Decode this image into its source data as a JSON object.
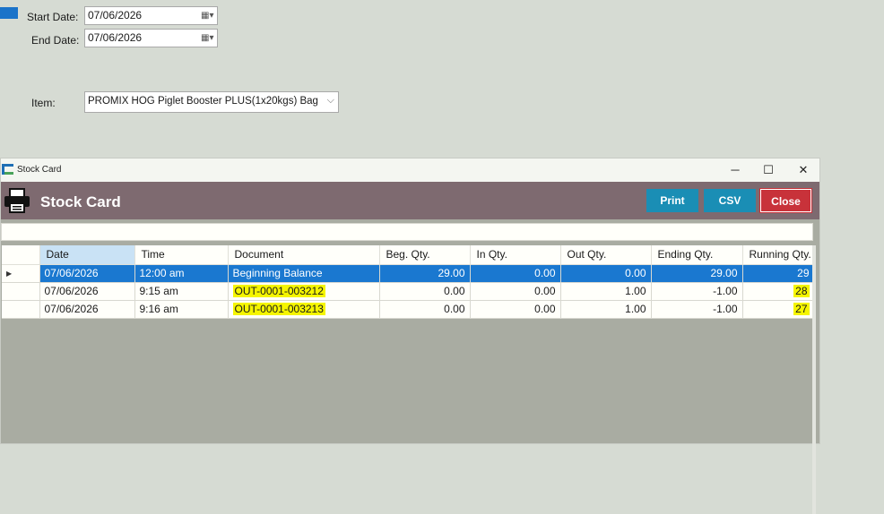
{
  "filters": {
    "start_date_label": "Start Date:",
    "start_date_value": "07/06/2026",
    "end_date_label": "End Date:",
    "end_date_value": "07/06/2026",
    "item_label": "Item:",
    "item_value": "PROMIX HOG Piglet Booster PLUS(1x20kgs)  Bag"
  },
  "window": {
    "title": "Stock Card",
    "minimize": "─",
    "maximize": "☐",
    "close": "✕"
  },
  "header": {
    "title": "Stock Card",
    "print_label": "Print",
    "csv_label": "CSV",
    "close_label": "Close"
  },
  "table": {
    "columns": [
      "Date",
      "Time",
      "Document",
      "Beg. Qty.",
      "In Qty.",
      "Out Qty.",
      "Ending Qty.",
      "Running Qty."
    ],
    "rows": [
      {
        "date": "07/06/2026",
        "time": "12:00 am",
        "document": "Beginning Balance",
        "beg": "29.00",
        "in": "0.00",
        "out": "0.00",
        "ending": "29.00",
        "running": "29"
      },
      {
        "date": "07/06/2026",
        "time": "9:15 am",
        "document": "OUT-0001-003212",
        "beg": "0.00",
        "in": "0.00",
        "out": "1.00",
        "ending": "-1.00",
        "running": "28"
      },
      {
        "date": "07/06/2026",
        "time": "9:16 am",
        "document": "OUT-0001-003213",
        "beg": "0.00",
        "in": "0.00",
        "out": "1.00",
        "ending": "-1.00",
        "running": "27"
      }
    ]
  },
  "colors": {
    "header_band": "#7e6a70",
    "button_blue": "#1a8eb5",
    "button_red": "#c8323a",
    "selected_row": "#1a78d0",
    "highlight": "#f5f500"
  }
}
